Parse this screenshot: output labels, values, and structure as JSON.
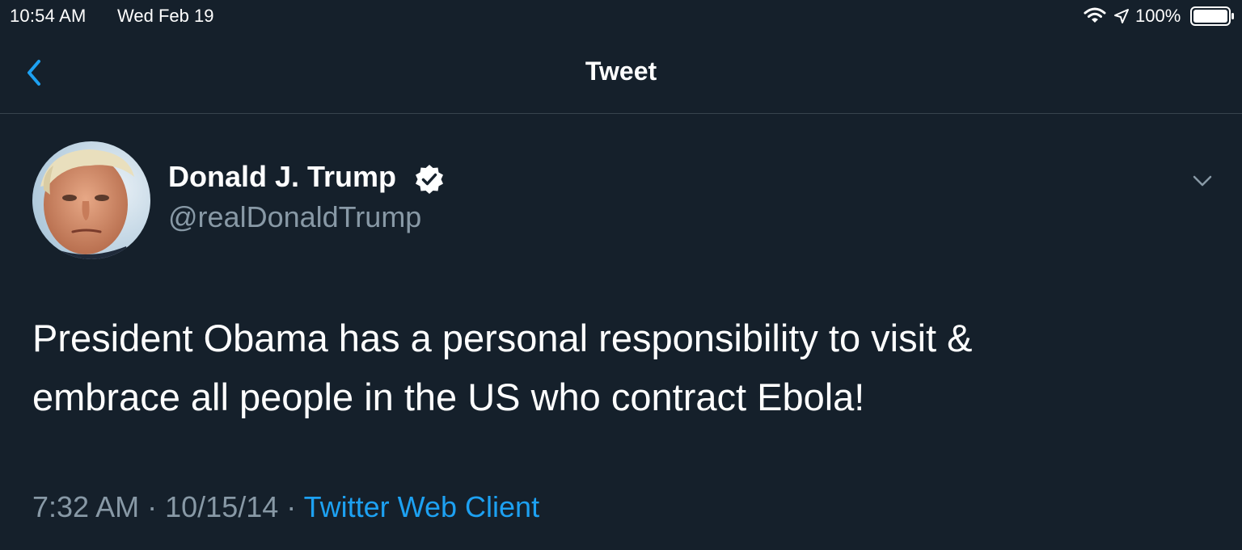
{
  "status_bar": {
    "time": "10:54 AM",
    "date": "Wed Feb 19",
    "battery_percent": "100%",
    "battery_level": 1.0,
    "icons": [
      "wifi-icon",
      "location-arrow-icon",
      "battery-icon"
    ]
  },
  "nav": {
    "title": "Tweet",
    "back_icon": "chevron-left-icon"
  },
  "tweet": {
    "author_name": "Donald J. Trump",
    "author_handle": "@realDonaldTrump",
    "verified": true,
    "text_line1": "President Obama has a personal responsibility to visit &",
    "text_line2": "embrace all people in the US who contract Ebola!",
    "time": "7:32 AM",
    "date": "10/15/14",
    "separator": "·",
    "source": "Twitter Web Client"
  },
  "colors": {
    "background": "#15202b",
    "divider": "#38444d",
    "accent": "#1da1f2",
    "secondary_text": "#8899a6",
    "primary_text": "#ffffff"
  }
}
